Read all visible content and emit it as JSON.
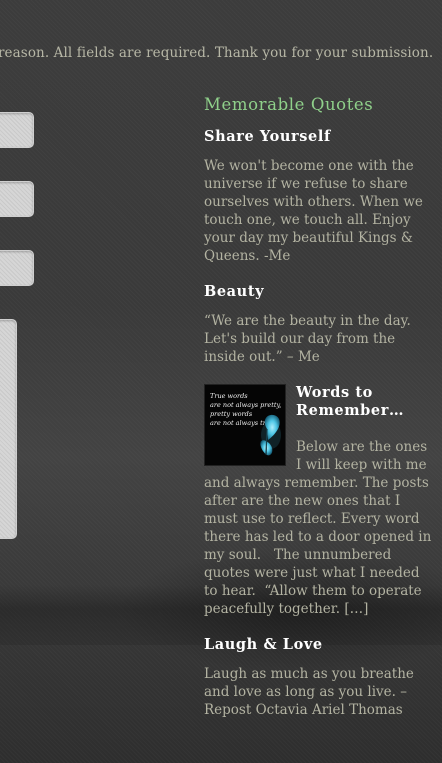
{
  "notice": "reason. All fields are required. Thank you for your submission.",
  "sidebar": {
    "widget_title": "Memorable Quotes",
    "posts": [
      {
        "title": "Share Yourself",
        "body": "We won't become one with the universe if we refuse to share ourselves with others. When we touch one, we touch all. Enjoy your day my beautiful Kings & Queens. -Me"
      },
      {
        "title": "Beauty",
        "body": "“We are the beauty in the day. Let's build our day from the inside out.” – Me"
      },
      {
        "title": "Words to Remember…",
        "body": "Below are the ones I will keep with me and always remember. The posts after are the new ones that I must use to reflect. Every word there has led to a door opened in my soul.   The unnumbered quotes were just what I needed to hear.  “Allow them to operate peacefully together.",
        "more": "[…]",
        "thumbnail_lines": [
          "True words",
          "are not always pretty,",
          "pretty words",
          "are not always true."
        ]
      },
      {
        "title": "Laugh & Love",
        "body": "Laugh as much as you breathe and love as long as you live. – Repost Octavia Ariel Thomas"
      }
    ]
  }
}
